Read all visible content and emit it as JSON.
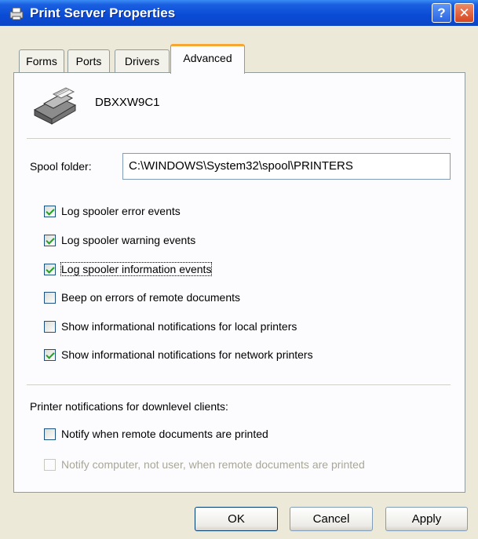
{
  "window": {
    "title": "Print Server Properties"
  },
  "titlebar": {
    "help_label": "?",
    "close_label": "✕"
  },
  "tabs": [
    {
      "label": "Forms",
      "active": false
    },
    {
      "label": "Ports",
      "active": false
    },
    {
      "label": "Drivers",
      "active": false
    },
    {
      "label": "Advanced",
      "active": true
    }
  ],
  "server": {
    "name": "DBXXW9C1"
  },
  "spool": {
    "label": "Spool folder:",
    "value": "C:\\WINDOWS\\System32\\spool\\PRINTERS"
  },
  "options": [
    {
      "label": "Log spooler error events",
      "checked": true
    },
    {
      "label": "Log spooler warning events",
      "checked": true
    },
    {
      "label": "Log spooler information events",
      "checked": true
    },
    {
      "label": "Beep on errors of remote documents",
      "checked": false
    },
    {
      "label": "Show informational notifications for local printers",
      "checked": false
    },
    {
      "label": "Show informational notifications for network printers",
      "checked": true
    }
  ],
  "downlevel": {
    "label": "Printer notifications for downlevel clients:",
    "options": [
      {
        "label": "Notify when remote documents are printed",
        "checked": false,
        "enabled": true
      },
      {
        "label": "Notify computer, not user, when remote documents are printed",
        "checked": false,
        "enabled": false
      }
    ]
  },
  "buttons": {
    "ok": "OK",
    "cancel": "Cancel",
    "apply": "Apply"
  }
}
